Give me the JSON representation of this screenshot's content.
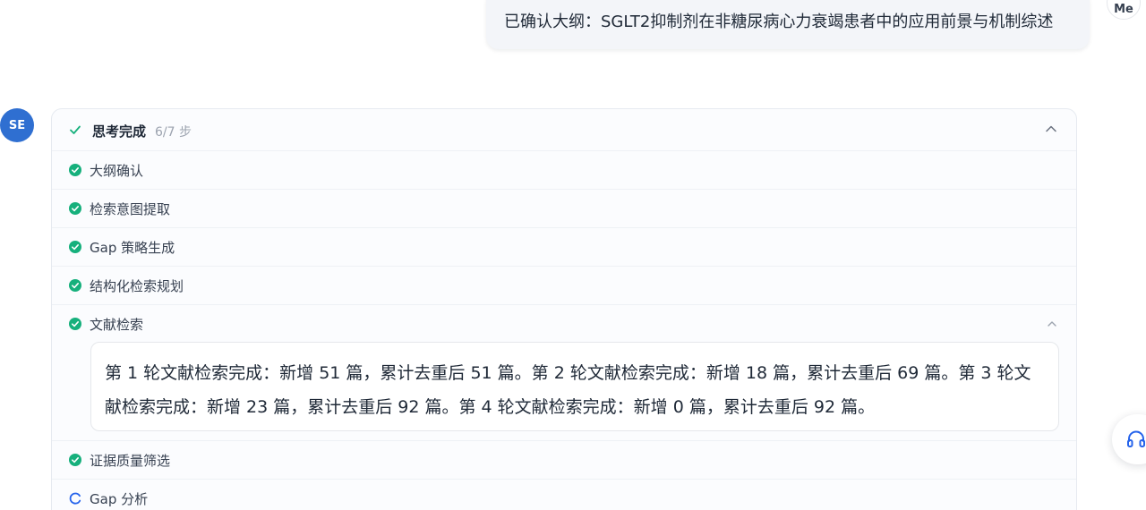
{
  "user_message": {
    "text": "已确认大纲：SGLT2抑制剂在非糖尿病心力衰竭患者中的应用前景与机制综述",
    "avatar": "Me"
  },
  "assistant": {
    "avatar": "SE",
    "thinking": {
      "title": "思考完成",
      "progress": "6/7 步",
      "icon": "check-icon",
      "steps": [
        {
          "label": "大纲确认",
          "status": "done"
        },
        {
          "label": "检索意图提取",
          "status": "done"
        },
        {
          "label": "Gap 策略生成",
          "status": "done"
        },
        {
          "label": "结构化检索规划",
          "status": "done"
        },
        {
          "label": "文献检索",
          "status": "done",
          "expanded": true,
          "detail": "第 1 轮文献检索完成：新增 51 篇，累计去重后 51 篇。第 2 轮文献检索完成：新增 18 篇，累计去重后 69 篇。第 3 轮文献检索完成：新增 23 篇，累计去重后 92 篇。第 4 轮文献检索完成：新增 0 篇，累计去重后 92 篇。"
        },
        {
          "label": "证据质量筛选",
          "status": "done"
        },
        {
          "label": "Gap 分析",
          "status": "in-progress"
        }
      ]
    }
  },
  "floating_button": {
    "icon": "headphones-icon"
  },
  "colors": {
    "accent": "#2f6fd1",
    "done": "#16b07c",
    "in_progress": "#2563eb"
  }
}
